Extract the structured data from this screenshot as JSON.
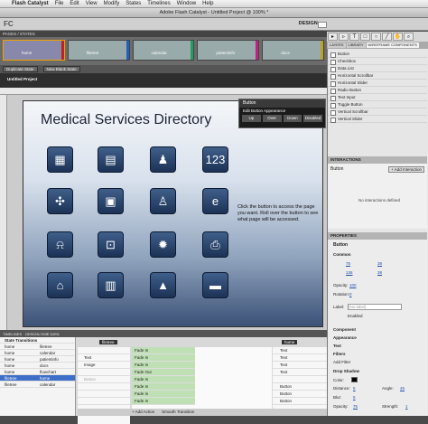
{
  "menubar": {
    "app": "Flash Catalyst",
    "items": [
      "File",
      "Edit",
      "View",
      "Modify",
      "States",
      "Timelines",
      "Window",
      "Help"
    ],
    "right": ""
  },
  "window": {
    "title": "Adobe Flash Catalyst - Untitled Project @ 100% *"
  },
  "toolbar": {
    "logo": "FC",
    "workspace": "DESIGN ▾"
  },
  "pages": {
    "header": "PAGES / STATES",
    "items": [
      {
        "name": "home",
        "color": "#c02020"
      },
      {
        "name": "filetree",
        "color": "#2060c0"
      },
      {
        "name": "calendar",
        "color": "#20a060"
      },
      {
        "name": "patientinfo",
        "color": "#c02080"
      },
      {
        "name": "docs",
        "color": "#c0a020"
      }
    ],
    "duplicate": "Duplicate State",
    "new_blank": "New Blank State"
  },
  "document": {
    "tab": "Untitled Project"
  },
  "canvas": {
    "title": "Medical Services Directory",
    "hint": "Click the button to access the page you want. Roll over the button to see what page will be accessed.",
    "tiles": [
      "▦",
      "▤",
      "♟",
      "123",
      "✣",
      "▣",
      "♙",
      "e",
      "⍾",
      "⊡",
      "✹",
      "⎙",
      "⌂",
      "▥",
      "▲",
      "▬"
    ]
  },
  "popup": {
    "title": "Button",
    "label": "Edit Button Appearance",
    "states": [
      "Up",
      "Over",
      "Down",
      "Disabled"
    ]
  },
  "right_tabs": [
    "LAYERS",
    "LIBRARY",
    "WIREFRAME COMPONENTS"
  ],
  "components": [
    "Button",
    "Checkbox",
    "Data List",
    "Horizontal Scrollbar",
    "Horizontal Slider",
    "Radio Button",
    "Text Input",
    "Toggle Button",
    "Vertical Scrollbar",
    "Vertical Slider"
  ],
  "interactions": {
    "header": "INTERACTIONS",
    "name": "Button",
    "add": "+ Add Interaction",
    "empty": "No interactions defined"
  },
  "properties": {
    "header": "PROPERTIES",
    "name": "Button",
    "section": "Common",
    "x": "75",
    "y": "136",
    "w": "38",
    "h": "38",
    "opacity_label": "Opacity:",
    "opacity": "100",
    "rotation_label": "Rotation:",
    "rotation": "0",
    "label_label": "Label:",
    "label_placeholder": "(No label)",
    "enabled": "Enabled",
    "sections": [
      "Component",
      "Appearance",
      "Text",
      "Filters"
    ],
    "add_filter": "Add Filter",
    "drop_shadow": "Drop Shadow",
    "color_label": "Color:",
    "distance_label": "Distance:",
    "distance": "5",
    "blur_label": "Blur:",
    "blur": "5",
    "opacity2_label": "Opacity:",
    "opacity2": "75",
    "angle_label": "Angle:",
    "angle": "45",
    "strength_label": "Strength:",
    "strength": "1"
  },
  "bottom": {
    "tabs": [
      "TIMELINES",
      "DESIGN-TIME DATA"
    ],
    "transitions_header": "State Transitions",
    "transitions": [
      [
        "home",
        "filetree"
      ],
      [
        "home",
        "calendar"
      ],
      [
        "home",
        "patientinfo"
      ],
      [
        "home",
        "docs"
      ],
      [
        "home",
        "flowchart"
      ],
      [
        "filetree",
        "home"
      ],
      [
        "filetree",
        "calendar"
      ]
    ],
    "selected_index": 5,
    "timeline_state": "filetree",
    "timeline_state2": "home",
    "timeline_names": [
      "",
      "Text",
      "Image",
      "",
      "Button",
      "",
      "",
      "",
      "Button"
    ],
    "timeline_bars": [
      "Fade In",
      "Fade In",
      "Fade In",
      "Fade Out",
      "Fade In",
      "Fade In",
      "Fade In",
      "Fade In",
      "Fade In"
    ],
    "right_names": [
      "Text",
      "Text",
      "Text",
      "Text",
      "",
      "Button",
      "Button",
      "Button",
      "Button"
    ],
    "add_action": "+ Add Action",
    "smooth": "Smooth Transition"
  }
}
